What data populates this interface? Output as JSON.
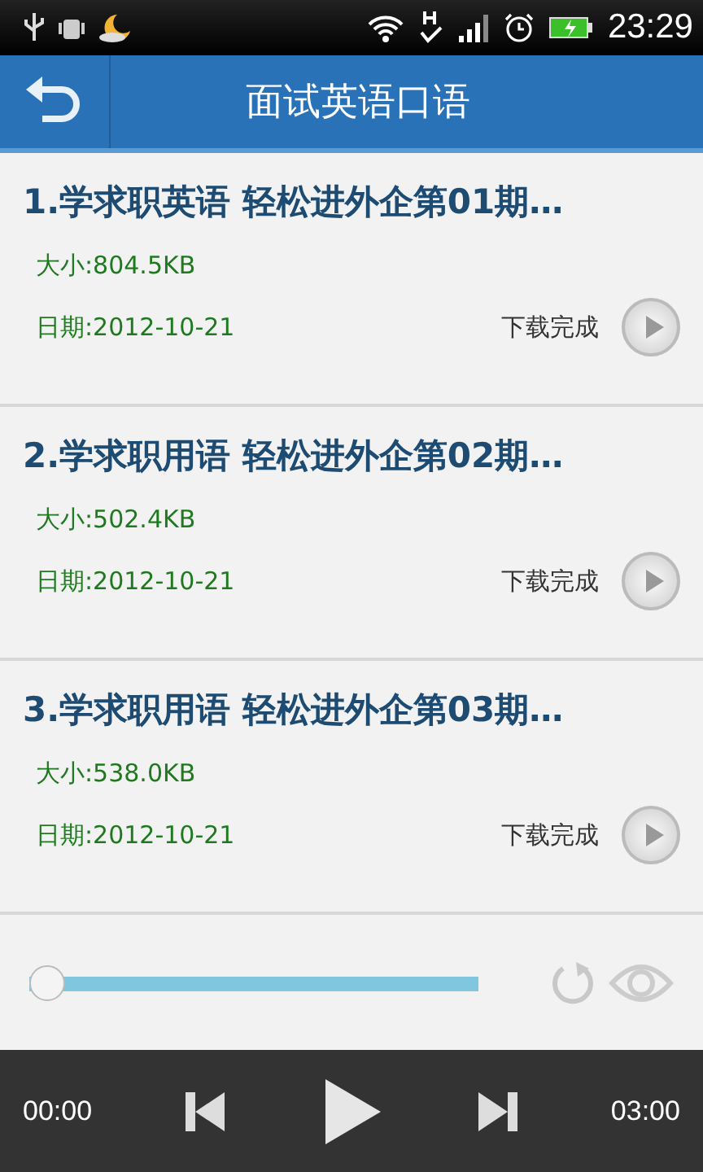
{
  "status_bar": {
    "time": "23:29"
  },
  "header": {
    "title": "面试英语口语"
  },
  "items": [
    {
      "title": "1.学求职英语 轻松进外企第01期…",
      "size": "大小:804.5KB",
      "date": "日期:2012-10-21",
      "status": "下载完成"
    },
    {
      "title": "2.学求职用语 轻松进外企第02期…",
      "size": "大小:502.4KB",
      "date": "日期:2012-10-21",
      "status": "下载完成"
    },
    {
      "title": "3.学求职用语 轻松进外企第03期…",
      "size": "大小:538.0KB",
      "date": "日期:2012-10-21",
      "status": "下载完成"
    }
  ],
  "player": {
    "level": 0,
    "elapsed": "00:00",
    "total": "03:00"
  }
}
